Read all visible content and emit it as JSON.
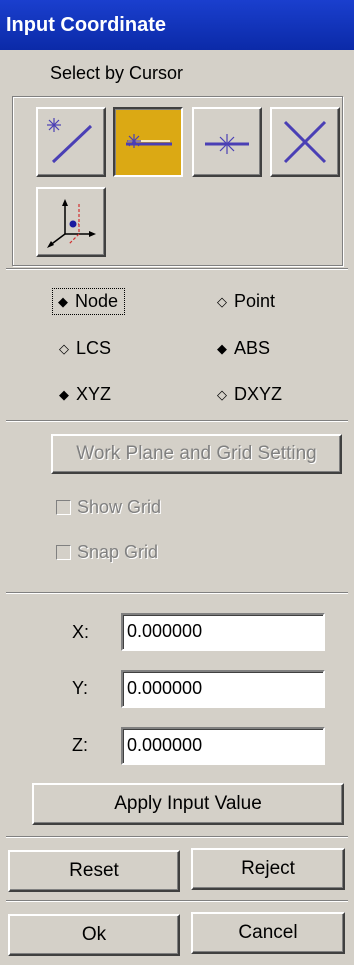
{
  "window": {
    "title": "Input Coordinate"
  },
  "cursor_group": {
    "label": "Select by Cursor"
  },
  "options": {
    "node": "Node",
    "point": "Point",
    "lcs": "LCS",
    "abs": "ABS",
    "xyz": "XYZ",
    "dxyz": "DXYZ"
  },
  "grid": {
    "work_plane_label": "Work Plane and Grid Setting",
    "show_grid": "Show Grid",
    "snap_grid": "Snap Grid"
  },
  "coords": {
    "x_label": "X:",
    "x_value": "0.000000",
    "y_label": "Y:",
    "y_value": "0.000000",
    "z_label": "Z:",
    "z_value": "0.000000",
    "apply_label": "Apply Input Value"
  },
  "buttons": {
    "reset": "Reset",
    "reject": "Reject",
    "ok": "Ok",
    "cancel": "Cancel"
  },
  "colors": {
    "title_bar": "#0b2aa8",
    "active_tool": "#dba914",
    "face": "#d4d0c8"
  }
}
